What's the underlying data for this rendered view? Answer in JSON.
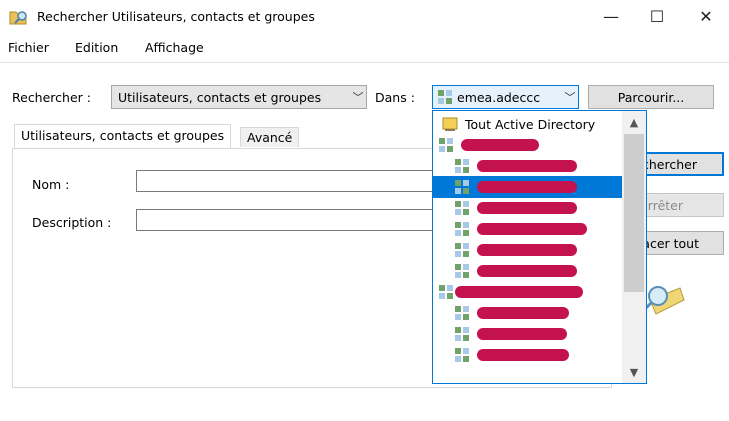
{
  "window": {
    "title": "Rechercher Utilisateurs, contacts et groupes",
    "minimize_glyph": "—",
    "maximize_glyph": "☐",
    "close_glyph": "✕"
  },
  "menu": [
    "Fichier",
    "Edition",
    "Affichage"
  ],
  "search": {
    "rechercher_label": "Rechercher :",
    "type_value": "Utilisateurs, contacts et groupes",
    "dans_label": "Dans :",
    "dans_value": "emea.adeccc",
    "browse_button": "Parcourir..."
  },
  "tabs": [
    {
      "label": "Utilisateurs, contacts et groupes",
      "active": true
    },
    {
      "label": "Avancé",
      "active": false
    }
  ],
  "form": {
    "nom_label": "Nom :",
    "nom_value": "",
    "description_label": "Description :",
    "description_value": ""
  },
  "buttons": {
    "search_now": "chercher",
    "stop": "rrêter",
    "clear_all": "acer tout"
  },
  "dropdown": {
    "first_item": "Tout Active Directory",
    "scroll_up_glyph": "▲",
    "scroll_down_glyph": "▼",
    "selected_index": 3,
    "item_count": 12
  },
  "colors": {
    "accent": "#0078d7",
    "redaction": "#c4124e"
  },
  "icons": [
    "search-folder-icon",
    "directory-icon",
    "domain-icon",
    "magnifier-icon"
  ]
}
